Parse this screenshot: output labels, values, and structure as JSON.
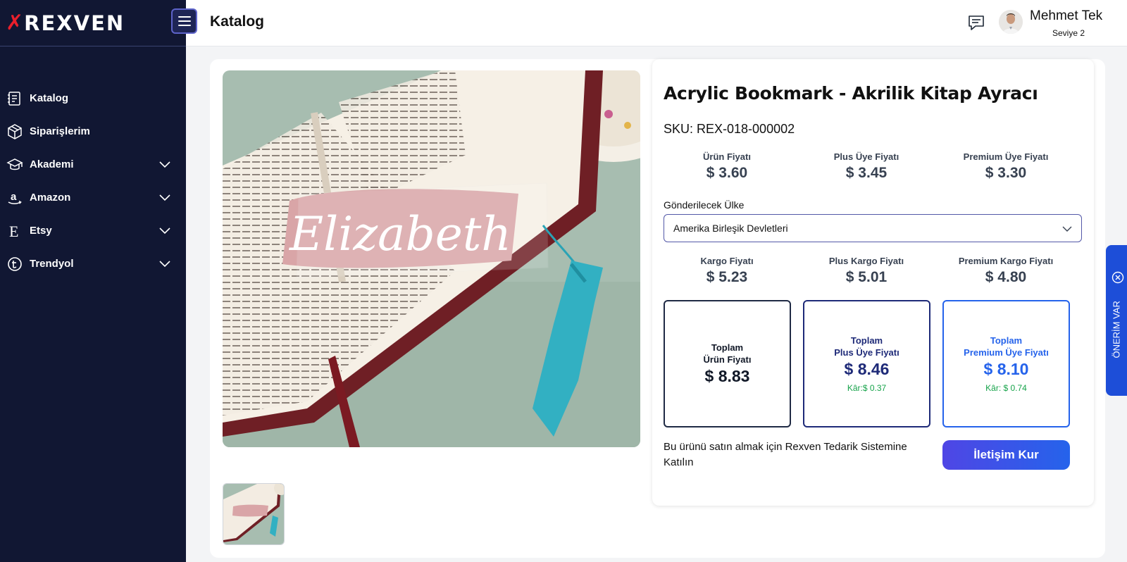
{
  "brand": {
    "logo_mark": "✗",
    "logo_text": "REXVEN"
  },
  "sidebar": {
    "items": [
      {
        "label": "Katalog",
        "icon": "catalog-icon",
        "expandable": false
      },
      {
        "label": "Siparişlerim",
        "icon": "box-icon",
        "expandable": false
      },
      {
        "label": "Akademi",
        "icon": "graduation-cap-icon",
        "expandable": true
      },
      {
        "label": "Amazon",
        "icon": "amazon-icon",
        "expandable": true
      },
      {
        "label": "Etsy",
        "icon": "etsy-icon",
        "expandable": true
      },
      {
        "label": "Trendyol",
        "icon": "trendyol-icon",
        "expandable": true
      }
    ]
  },
  "header": {
    "title": "Katalog",
    "user_name": "Mehmet Tek",
    "user_level": "Seviye 2"
  },
  "product": {
    "title": "Acrylic Bookmark - Akrilik Kitap Ayracı",
    "sku": "SKU: REX-018-000002",
    "image_text": "Elizabeth",
    "prices": [
      {
        "label": "Ürün Fiyatı",
        "value": "$ 3.60"
      },
      {
        "label": "Plus Üye Fiyatı",
        "value": "$ 3.45"
      },
      {
        "label": "Premium Üye Fiyatı",
        "value": "$ 3.30"
      }
    ],
    "country_label": "Gönderilecek Ülke",
    "country_value": "Amerika Birleşik Devletleri",
    "shipping": [
      {
        "label": "Kargo Fiyatı",
        "value": "$ 5.23"
      },
      {
        "label": "Plus Kargo Fiyatı",
        "value": "$ 5.01"
      },
      {
        "label": "Premium Kargo Fiyatı",
        "value": "$ 4.80"
      }
    ],
    "totals": [
      {
        "label_1": "Toplam",
        "label_2": "Ürün Fiyatı",
        "value": "$ 8.83",
        "profit": ""
      },
      {
        "label_1": "Toplam",
        "label_2": "Plus Üye Fiyatı",
        "value": "$ 8.46",
        "profit": "Kâr:$ 0.37"
      },
      {
        "label_1": "Toplam",
        "label_2": "Premium Üye Fiyatı",
        "value": "$ 8.10",
        "profit": "Kâr: $ 0.74"
      }
    ],
    "join_text": "Bu ürünü satın almak için Rexven Tedarik Sistemine Katılın",
    "contact_button": "İletişim Kur"
  },
  "suggestion_tab": {
    "label": "ÖNERİM VAR"
  },
  "colors": {
    "sidebar_bg": "#111733",
    "brand_red": "#ea1f2b",
    "plus_navy": "#1e2a78",
    "premium_blue": "#2563eb",
    "profit_green": "#16a34a",
    "cta_start": "#4f46e5",
    "cta_end": "#2563eb"
  }
}
